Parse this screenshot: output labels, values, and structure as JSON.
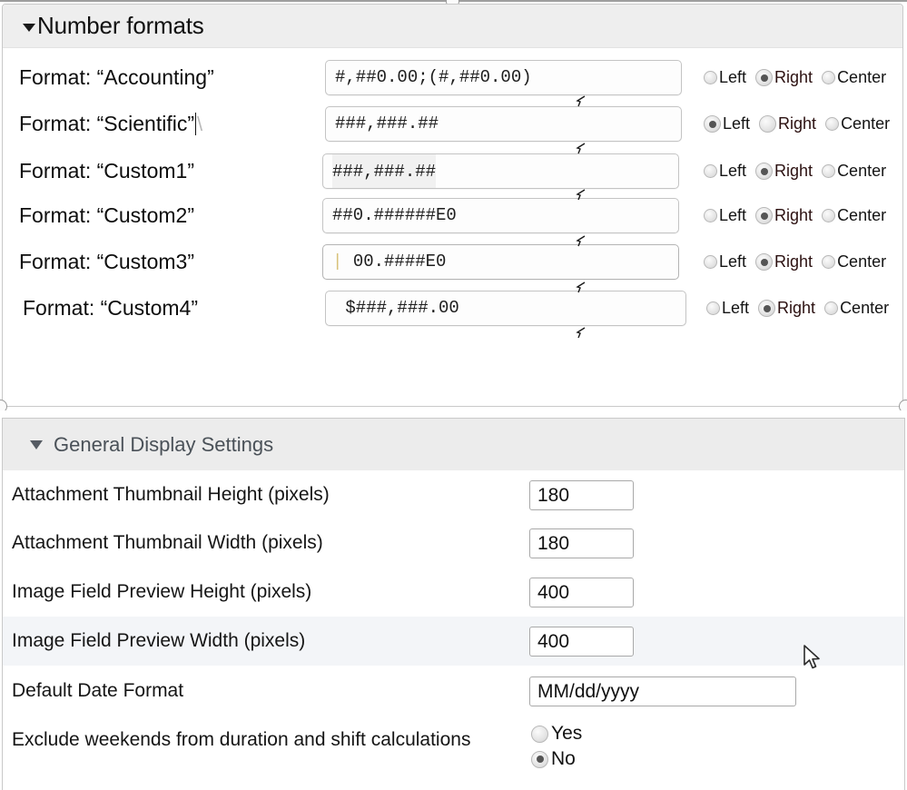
{
  "number_formats": {
    "title": "Number formats",
    "collapse_icon": "triangle-down-icon",
    "alignment_options": [
      "Left",
      "Right",
      "Center"
    ],
    "rows": [
      {
        "label": "Format: “Accounting”",
        "value": "#,##0.00;(#,##0.00)",
        "alignment": "Right"
      },
      {
        "label": "Format: “Scientific”",
        "value": "###,###.##",
        "alignment": "Left"
      },
      {
        "label": "Format: “Custom1”",
        "value": "###,###.##",
        "alignment": "Right"
      },
      {
        "label": "Format: “Custom2”",
        "value": "##0.######E0",
        "alignment": "Right"
      },
      {
        "label": "Format: “Custom3”",
        "value": "00.####E0",
        "alignment": "Right"
      },
      {
        "label": "Format: “Custom4”",
        "value": "$###,###.00",
        "alignment": "Right"
      }
    ]
  },
  "general_display": {
    "title": "General Display Settings",
    "collapse_icon": "triangle-down-icon",
    "rows": [
      {
        "label": "Attachment Thumbnail Height (pixels)",
        "value": "180"
      },
      {
        "label": "Attachment Thumbnail Width (pixels)",
        "value": "180"
      },
      {
        "label": "Image Field Preview Height (pixels)",
        "value": "400"
      },
      {
        "label": "Image Field Preview Width (pixels)",
        "value": "400"
      },
      {
        "label": "Default Date Format",
        "value": "MM/dd/yyyy"
      }
    ],
    "weekends": {
      "label": "Exclude weekends from duration and shift calculations",
      "options": [
        "Yes",
        "No"
      ],
      "selected": "No"
    }
  },
  "colors": {
    "panel_header_dark": "#eeeeee",
    "panel_header_light": "#ececec",
    "alt_row": "#f3f5f8",
    "border": "#c9c9c9",
    "text": "#111111",
    "header_light_text": "#4a5158"
  }
}
